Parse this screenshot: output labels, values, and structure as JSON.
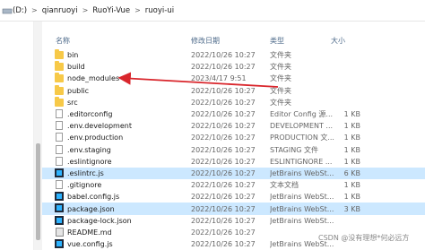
{
  "breadcrumb": {
    "drive": "(D:)",
    "parts": [
      "qianruoyi",
      "RuoYi-Vue",
      "ruoyi-ui"
    ],
    "separator": ">"
  },
  "columns": {
    "name": "名称",
    "date": "修改日期",
    "type": "类型",
    "size": "大小"
  },
  "files": [
    {
      "name": "bin",
      "date": "2022/10/26 10:27",
      "type": "文件夹",
      "size": "",
      "icon": "folder-icon"
    },
    {
      "name": "build",
      "date": "2022/10/26 10:27",
      "type": "文件夹",
      "size": "",
      "icon": "folder-icon"
    },
    {
      "name": "node_modules",
      "date": "2023/4/17 9:51",
      "type": "文件夹",
      "size": "",
      "icon": "folder-icon"
    },
    {
      "name": "public",
      "date": "2022/10/26 10:27",
      "type": "文件夹",
      "size": "",
      "icon": "folder-icon"
    },
    {
      "name": "src",
      "date": "2022/10/26 10:27",
      "type": "文件夹",
      "size": "",
      "icon": "folder-icon"
    },
    {
      "name": ".editorconfig",
      "date": "2022/10/26 10:27",
      "type": "Editor Config 源...",
      "size": "1 KB",
      "icon": "file-icon"
    },
    {
      "name": ".env.development",
      "date": "2022/10/26 10:27",
      "type": "DEVELOPMENT ...",
      "size": "1 KB",
      "icon": "file-icon"
    },
    {
      "name": ".env.production",
      "date": "2022/10/26 10:27",
      "type": "PRODUCTION 文...",
      "size": "1 KB",
      "icon": "file-icon"
    },
    {
      "name": ".env.staging",
      "date": "2022/10/26 10:27",
      "type": "STAGING 文件",
      "size": "1 KB",
      "icon": "file-icon"
    },
    {
      "name": ".eslintignore",
      "date": "2022/10/26 10:27",
      "type": "ESLINTIGNORE ...",
      "size": "1 KB",
      "icon": "file-icon"
    },
    {
      "name": ".eslintrc.js",
      "date": "2022/10/26 10:27",
      "type": "JetBrains WebSt...",
      "size": "6 KB",
      "icon": "jetbrains-icon",
      "selected": true
    },
    {
      "name": ".gitignore",
      "date": "2022/10/26 10:27",
      "type": "文本文档",
      "size": "1 KB",
      "icon": "file-icon"
    },
    {
      "name": "babel.config.js",
      "date": "2022/10/26 10:27",
      "type": "JetBrains WebSt...",
      "size": "1 KB",
      "icon": "jetbrains-icon"
    },
    {
      "name": "package.json",
      "date": "2022/10/26 10:27",
      "type": "JetBrains WebSt...",
      "size": "3 KB",
      "icon": "jetbrains-icon",
      "selected": true
    },
    {
      "name": "package-lock.json",
      "date": "2022/10/26 10:27",
      "type": "JetBrains WebSt...",
      "size": "",
      "icon": "jetbrains-icon"
    },
    {
      "name": "README.md",
      "date": "2022/10/26 10:27",
      "type": "",
      "size": "",
      "icon": "markdown-icon"
    },
    {
      "name": "vue.config.js",
      "date": "2022/10/26 10:27",
      "type": "JetBrains WebSt...",
      "size": "",
      "icon": "jetbrains-icon"
    }
  ],
  "watermark": "CSDN @没有理想*何必远方",
  "colors": {
    "arrow": "#d9262c",
    "selection": "#cce8ff",
    "folder": "#f7c948"
  }
}
